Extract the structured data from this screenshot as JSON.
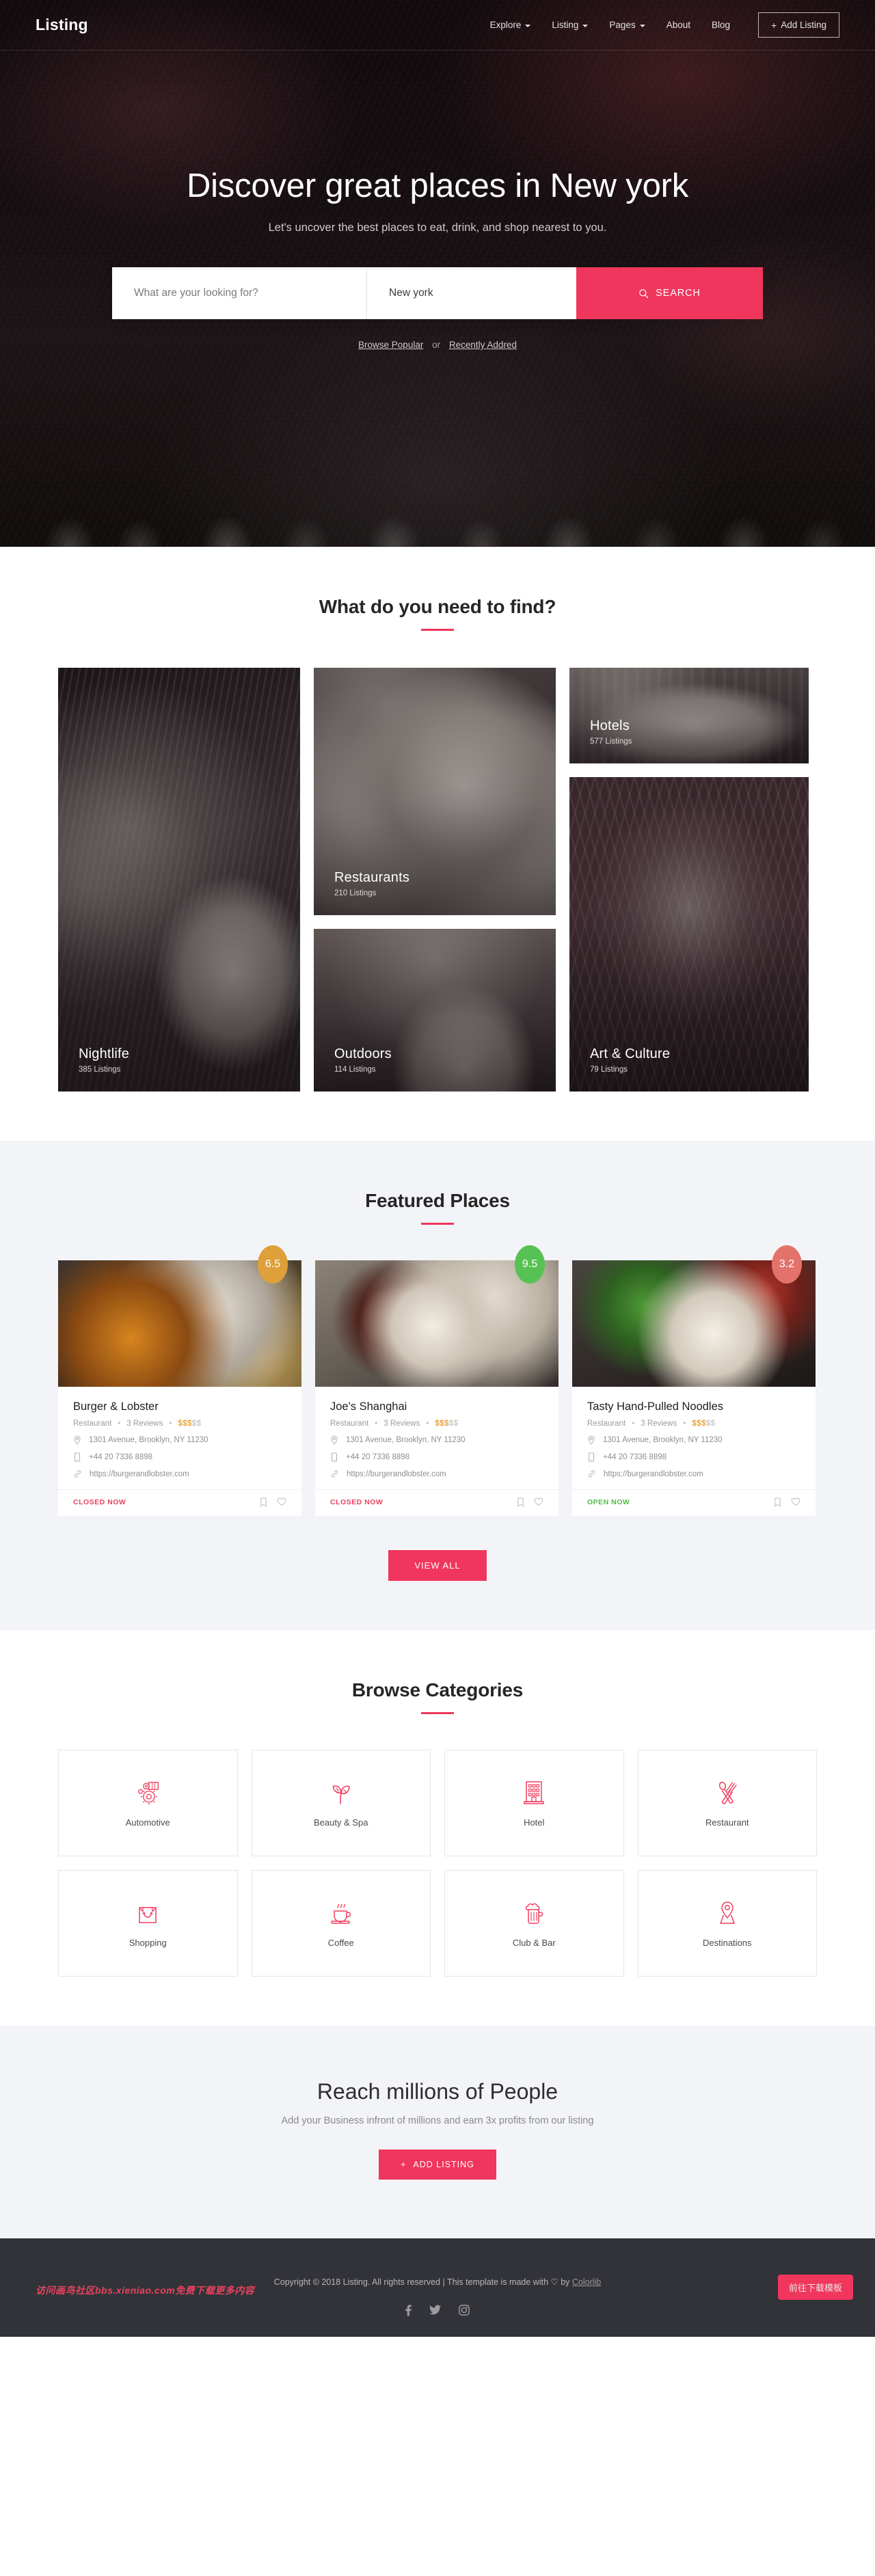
{
  "header": {
    "brand": "Listing",
    "nav": [
      {
        "label": "Explore",
        "has_caret": true
      },
      {
        "label": "Listing",
        "has_caret": true
      },
      {
        "label": "Pages",
        "has_caret": true
      },
      {
        "label": "About",
        "has_caret": false
      },
      {
        "label": "Blog",
        "has_caret": false
      }
    ],
    "add_listing_label": "Add Listing",
    "add_listing_plus": "+"
  },
  "hero": {
    "title": "Discover great places in New york",
    "subtitle": "Let's uncover the best places to eat, drink, and shop nearest to you.",
    "search": {
      "query_placeholder": "What are your looking for?",
      "location_value": "New york",
      "button_label": "SEARCH"
    },
    "browse_prefix": "Browse",
    "browse_popular": "Browse Popular",
    "browse_or": "or",
    "browse_recent": "Recently Addred"
  },
  "find_section": {
    "title": "What do you need to find?",
    "cards": [
      {
        "name": "Nightlife",
        "count": "385 Listings",
        "theme": "ph-night"
      },
      {
        "name": "Restaurants",
        "count": "210 Listings",
        "theme": "ph-rest"
      },
      {
        "name": "Outdoors",
        "count": "114 Listings",
        "theme": "ph-out"
      },
      {
        "name": "Hotels",
        "count": "577 Listings",
        "theme": "ph-hotel"
      },
      {
        "name": "Art & Culture",
        "count": "79 Listings",
        "theme": "ph-art"
      }
    ]
  },
  "featured": {
    "title": "Featured Places",
    "view_all_label": "VIEW ALL",
    "places": [
      {
        "name": "Burger & Lobster",
        "category": "Restaurant",
        "reviews": "3 Reviews",
        "price_on": "$$$",
        "price_off": "$$",
        "address": "1301 Avenue, Brooklyn, NY 11230",
        "phone": "+44 20 7336 8898",
        "website": "https://burgerandlobster.com",
        "status": "CLOSED NOW",
        "status_type": "closed",
        "rating": "6.5",
        "rating_color": "#dda03b",
        "img": "pimg-a"
      },
      {
        "name": "Joe's Shanghai",
        "category": "Restaurant",
        "reviews": "3 Reviews",
        "price_on": "$$$",
        "price_off": "$$",
        "address": "1301 Avenue, Brooklyn, NY 11230",
        "phone": "+44 20 7336 8898",
        "website": "https://burgerandlobster.com",
        "status": "CLOSED NOW",
        "status_type": "closed",
        "rating": "9.5",
        "rating_color": "#57c254",
        "img": "pimg-b"
      },
      {
        "name": "Tasty Hand-Pulled Noodles",
        "category": "Restaurant",
        "reviews": "3 Reviews",
        "price_on": "$$$",
        "price_off": "$$",
        "address": "1301 Avenue, Brooklyn, NY 11230",
        "phone": "+44 20 7336 8898",
        "website": "https://burgerandlobster.com",
        "status": "OPEN NOW",
        "status_type": "open",
        "rating": "3.2",
        "rating_color": "#e3736a",
        "img": "pimg-c"
      }
    ]
  },
  "browse_categories": {
    "title": "Browse Categories",
    "items": [
      {
        "label": "Automotive",
        "icon": "automotive-gear-icon"
      },
      {
        "label": "Beauty & Spa",
        "icon": "leaf-plant-icon"
      },
      {
        "label": "Hotel",
        "icon": "building-icon"
      },
      {
        "label": "Restaurant",
        "icon": "fork-spoon-icon"
      },
      {
        "label": "Shopping",
        "icon": "shopping-bag-icon"
      },
      {
        "label": "Coffee",
        "icon": "coffee-cup-icon"
      },
      {
        "label": "Club & Bar",
        "icon": "beer-mug-icon"
      },
      {
        "label": "Destinations",
        "icon": "map-pin-icon"
      }
    ]
  },
  "cta": {
    "title": "Reach millions of People",
    "subtitle": "Add your Business infront of millions and earn 3x profits from our listing",
    "button_label": "ADD LISTING",
    "button_plus": "+"
  },
  "footer": {
    "copyright_pre": "Copyright © 2018 Listing. All rights reserved | This template is made with ",
    "heart": "♡",
    "copyright_by": " by ",
    "brand_link": "Colorlib",
    "socials": [
      "facebook-icon",
      "twitter-icon",
      "instagram-icon"
    ],
    "watermark": "访问画鸟社区bbs.xieniao.com免费下载更多内容",
    "download_button": "前往下载模板"
  },
  "colors": {
    "accent": "#f0365c",
    "dark": "#323338",
    "gray_bg": "#f3f4f8"
  }
}
